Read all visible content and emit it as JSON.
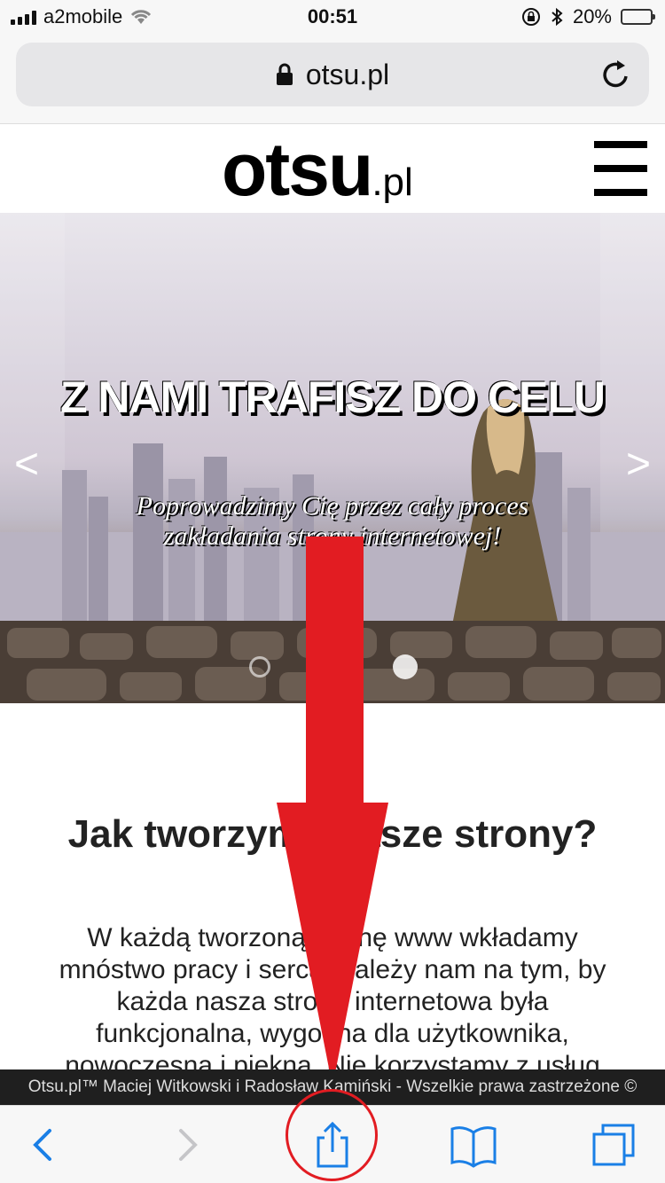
{
  "status_bar": {
    "carrier": "a2mobile",
    "time": "00:51",
    "battery_percent": "20%",
    "battery_level": 0.2,
    "icons": [
      "signal-icon",
      "wifi-icon",
      "orientation-lock-icon",
      "bluetooth-icon",
      "battery-icon"
    ]
  },
  "browser": {
    "url": "otsu.pl",
    "icons": [
      "lock-icon",
      "reload-icon"
    ]
  },
  "site": {
    "logo_main": "otsu",
    "logo_suffix": ".pl",
    "menu_icon": "hamburger-icon"
  },
  "hero": {
    "title": "Z NAMI TRAFISZ DO CELU",
    "subtitle": "Poprowadzimy Cię przez cały proces zakładania strony internetowej!",
    "prev_label": "<",
    "next_label": ">",
    "slides": 2,
    "active_slide": 2
  },
  "content": {
    "heading": "Jak tworzymy nasze strony?",
    "paragraph": "W każdą tworzoną stronę www wkładamy mnóstwo pracy i serca. Zależy nam na tym, by każda nasza strona internetowa była funkcjonalna, wygodna dla użytkownika, nowoczesna i piękna. Nie korzystamy z usług dodatkowych podwykonawców, co sprawia"
  },
  "footer": {
    "text": "Otsu.pl™ Maciej Witkowski i Radosław Kamiński - Wszelkie prawa zastrzeżone ©"
  },
  "toolbar": {
    "icons": [
      "back-icon",
      "forward-icon",
      "share-icon",
      "bookmarks-icon",
      "tabs-icon"
    ]
  },
  "colors": {
    "annotation": "#e21c22",
    "ios_blue": "#1a7fe6",
    "battery": "#f4c20d"
  }
}
